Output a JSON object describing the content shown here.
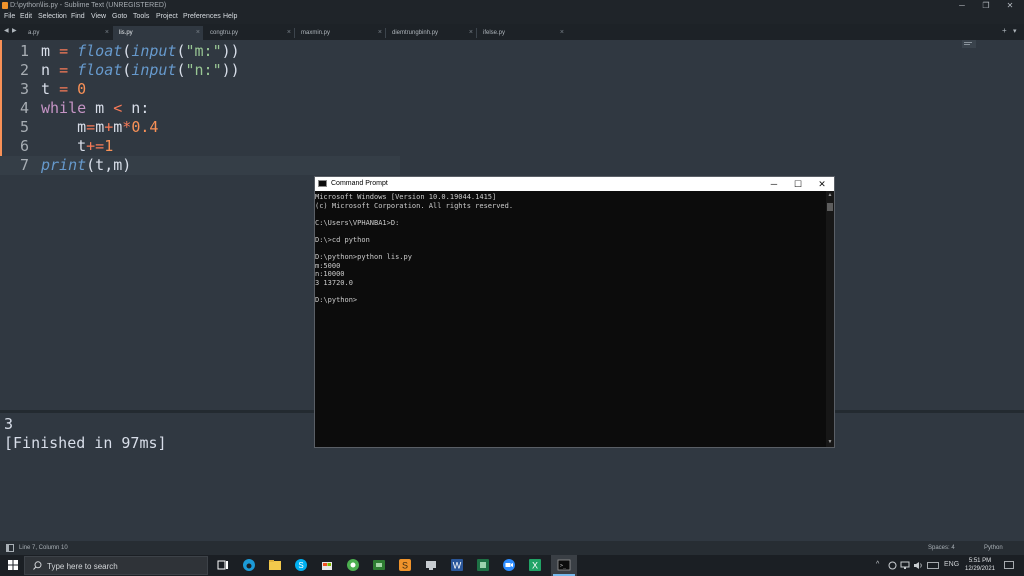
{
  "window": {
    "title": "D:\\python\\lis.py - Sublime Text (UNREGISTERED)",
    "minimize": "─",
    "maximize": "❐",
    "close": "✕"
  },
  "menu": [
    "File",
    "Edit",
    "Selection",
    "Find",
    "View",
    "Goto",
    "Tools",
    "Project",
    "Preferences",
    "Help"
  ],
  "tabs": [
    {
      "label": "a.py",
      "active": false
    },
    {
      "label": "lis.py",
      "active": true
    },
    {
      "label": "congtru.py",
      "active": false
    },
    {
      "label": "maxmin.py",
      "active": false
    },
    {
      "label": "diemtrungbinh.py",
      "active": false
    },
    {
      "label": "ifelse.py",
      "active": false
    }
  ],
  "tab_nav": {
    "prev": "◀",
    "next": "▶",
    "add": "+",
    "dropdown": "▾"
  },
  "editor": {
    "line_numbers": [
      "1",
      "2",
      "3",
      "4",
      "5",
      "6",
      "7"
    ],
    "current_line": 7
  },
  "output": {
    "lines": [
      "3",
      "[Finished in 97ms]"
    ]
  },
  "status_bar": {
    "position": "Line 7, Column 10",
    "indent": "Spaces: 4",
    "syntax": "Python"
  },
  "cmd_window": {
    "title": "Command Prompt",
    "lines": [
      "Microsoft Windows [Version 10.0.19044.1415]",
      "(c) Microsoft Corporation. All rights reserved.",
      "",
      "C:\\Users\\VPHANBA1>D:",
      "",
      "D:\\>cd python",
      "",
      "D:\\python>python lis.py",
      "m:5000",
      "n:10000",
      "3 13720.0",
      "",
      "D:\\python>"
    ]
  },
  "taskbar": {
    "search_placeholder": "Type here to search",
    "language": "ENG",
    "time": "5:51 PM",
    "date": "12/29/2021",
    "icons": [
      "task-view-icon",
      "edge-icon",
      "file-explorer-icon",
      "skype-icon",
      "store-icon",
      "chrome-icon",
      "green-app-icon",
      "sublime-text-icon",
      "network-app-icon",
      "word-icon",
      "excel-green-icon",
      "zoom-icon",
      "excel-icon",
      "command-prompt-icon"
    ],
    "colors": {
      "edge": "#1c9bd8",
      "explorer": "#f2c94c",
      "skype": "#00aff0",
      "sublime": "#f0932b",
      "word": "#2b579a",
      "excel": "#21a366",
      "zoom": "#2d8cff"
    }
  }
}
